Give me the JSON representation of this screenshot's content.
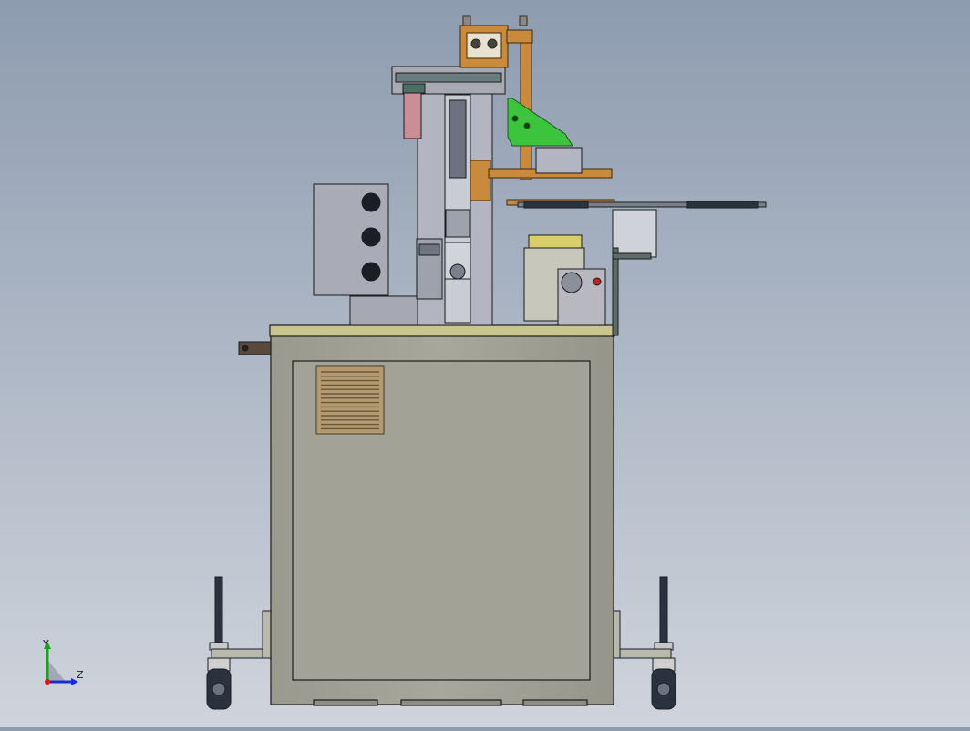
{
  "viewport": {
    "background_top": "#8e9cb0",
    "background_bottom": "#cfd4dc"
  },
  "triad": {
    "y_label": "Y",
    "z_label": "Z",
    "y_axis_color": "#1aa01a",
    "z_axis_color": "#1a2ed0",
    "x_axis_color": "#d01a1a"
  },
  "colors": {
    "cabinet": "#a5a498",
    "tabletop": "#c9c58f",
    "vent": "#b39a72",
    "bracket_orange": "#c98a3c",
    "plate_green": "#3cc43c",
    "block_yellow": "#d8cf6a",
    "pink_block": "#c98e96",
    "caster": "#2a3240"
  }
}
